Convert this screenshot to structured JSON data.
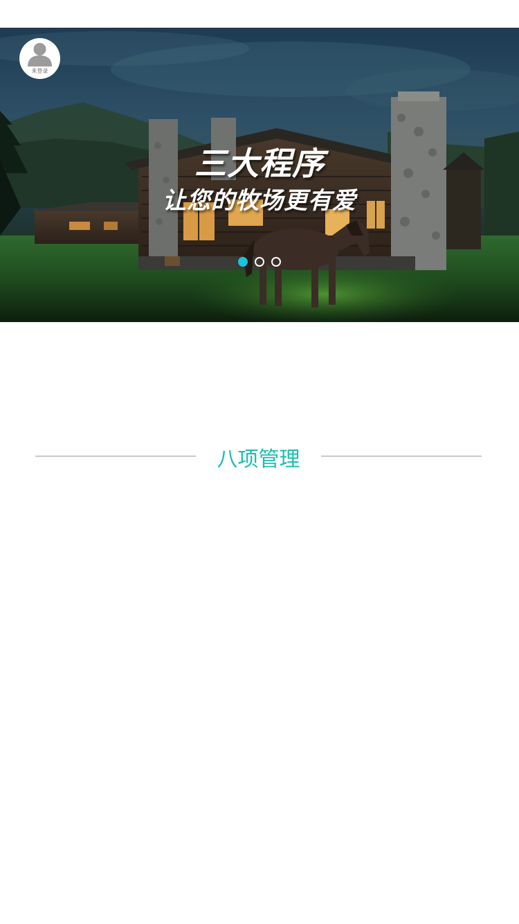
{
  "banner": {
    "title": "三大程序",
    "subtitle": "让您的牧场更有爱",
    "slides": 3,
    "active_slide": 1,
    "indicator_active_color": "#19c3dc"
  },
  "user": {
    "login_status": "未登录"
  },
  "section": {
    "title": "八项管理",
    "title_color": "#1abfb0"
  }
}
